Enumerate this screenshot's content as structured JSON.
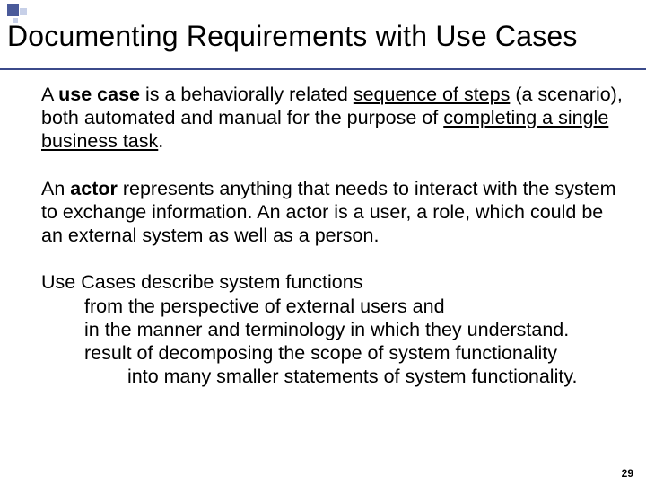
{
  "title": "Documenting Requirements with Use Cases",
  "p1": {
    "t1": "A ",
    "b1": "use case",
    "t2": " is a behaviorally related ",
    "u1": "sequence of steps",
    "t3": " (a scenario), both automated and manual for the purpose of ",
    "u2": "completing a single business task",
    "t4": "."
  },
  "p2": {
    "t1": "An ",
    "b1": "actor",
    "t2": " represents anything that needs to interact with the system to exchange information. An actor is a user, a role, which could be an external system as well as a person."
  },
  "p3": {
    "line1": "Use Cases describe system functions",
    "line2": "from the perspective of external users and",
    "line3": "in the manner and terminology in which they understand.",
    "line4": "result of decomposing the scope of system functionality",
    "line5": "into many smaller statements of system functionality."
  },
  "pageNumber": "29"
}
